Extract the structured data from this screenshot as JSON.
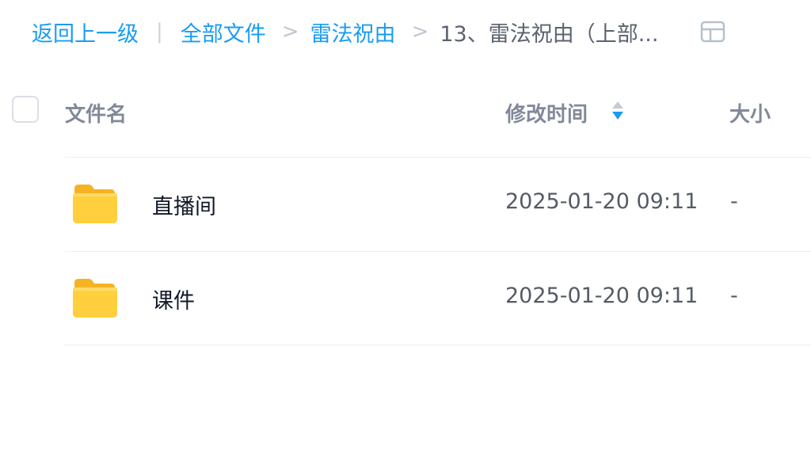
{
  "breadcrumb": {
    "back_label": "返回上一级",
    "divider": "|",
    "separator": ">",
    "items": [
      {
        "label": "全部文件"
      },
      {
        "label": "雷法祝由"
      }
    ],
    "current": "13、雷法祝由（上部..."
  },
  "view_toggle": {
    "icon": "grid-view-icon"
  },
  "table": {
    "columns": {
      "name": "文件名",
      "mtime": "修改时间",
      "size": "大小"
    },
    "sort": {
      "column": "mtime",
      "direction": "desc",
      "icon": "sort-arrows-icon"
    },
    "rows": [
      {
        "name": "直播间",
        "mtime": "2025-01-20 09:11",
        "size": "-",
        "icon": "folder-icon"
      },
      {
        "name": "课件",
        "mtime": "2025-01-20 09:11",
        "size": "-",
        "icon": "folder-icon"
      }
    ]
  },
  "colors": {
    "link": "#1a9df0",
    "folder": "#ffc83d",
    "sort_active": "#1a9df0"
  }
}
